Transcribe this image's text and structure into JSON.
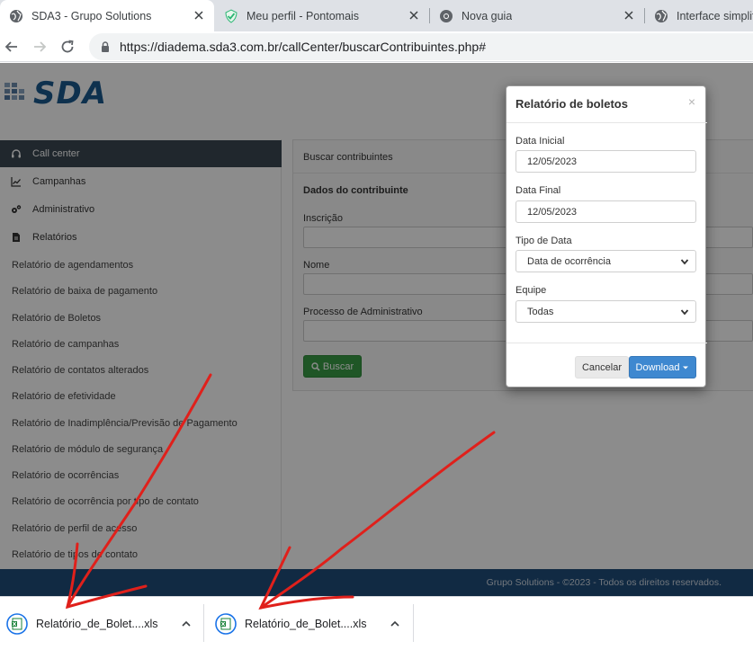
{
  "tabs": [
    {
      "title": "SDA3 - Grupo Solutions",
      "favicon": "globe-icon",
      "active": true
    },
    {
      "title": "Meu perfil - Pontomais",
      "favicon": "check-shield-icon",
      "active": false
    },
    {
      "title": "Nova guia",
      "favicon": "chrome-icon",
      "active": false
    },
    {
      "title": "Interface simplif",
      "favicon": "globe-icon",
      "active": false
    }
  ],
  "address_bar": {
    "url": "https://diadema.sda3.com.br/callCenter/buscarContribuintes.php#"
  },
  "logo": {
    "text": "SDA"
  },
  "sidebar": {
    "sections": [
      {
        "label": "Call center",
        "icon": "headset-icon"
      },
      {
        "label": "Campanhas",
        "icon": "chart-line-icon"
      },
      {
        "label": "Administrativo",
        "icon": "gears-icon"
      },
      {
        "label": "Relatórios",
        "icon": "file-icon"
      }
    ],
    "links": [
      "Relatório de agendamentos",
      "Relatório de baixa de pagamento",
      "Relatório de Boletos",
      "Relatório de campanhas",
      "Relatório de contatos alterados",
      "Relatório de efetividade",
      "Relatório de Inadimplência/Previsão de Pagamento",
      "Relatório de módulo de segurança",
      "Relatório de ocorrências",
      "Relatório de ocorrência por tipo de contato",
      "Relatório de perfil de acesso",
      "Relatório de tipos de contato"
    ]
  },
  "search_panel": {
    "heading": "Buscar contribuintes",
    "subheading": "Dados do contribuinte",
    "fields": [
      "Inscrição",
      "Nome",
      "Processo de Administrativo"
    ],
    "button": "Buscar"
  },
  "footer": {
    "text": "Grupo Solutions - ©2023 - Todos os direitos reservados."
  },
  "modal": {
    "title": "Relatório de boletos",
    "close": "×",
    "data_inicial": {
      "label": "Data Inicial",
      "value": "12/05/2023"
    },
    "data_final": {
      "label": "Data Final",
      "value": "12/05/2023"
    },
    "tipo_data": {
      "label": "Tipo de Data",
      "value": "Data de ocorrência"
    },
    "equipe": {
      "label": "Equipe",
      "value": "Todas"
    },
    "cancel": "Cancelar",
    "download": "Download"
  },
  "downloads": [
    {
      "filename": "Relatório_de_Bolet....xls"
    },
    {
      "filename": "Relatório_de_Bolet....xls"
    }
  ],
  "colors": {
    "annotation_red": "#e0201b",
    "footer_blue": "#1f4e7a",
    "download_blue": "#3e88d0",
    "buscar_green": "#3a9d46"
  }
}
